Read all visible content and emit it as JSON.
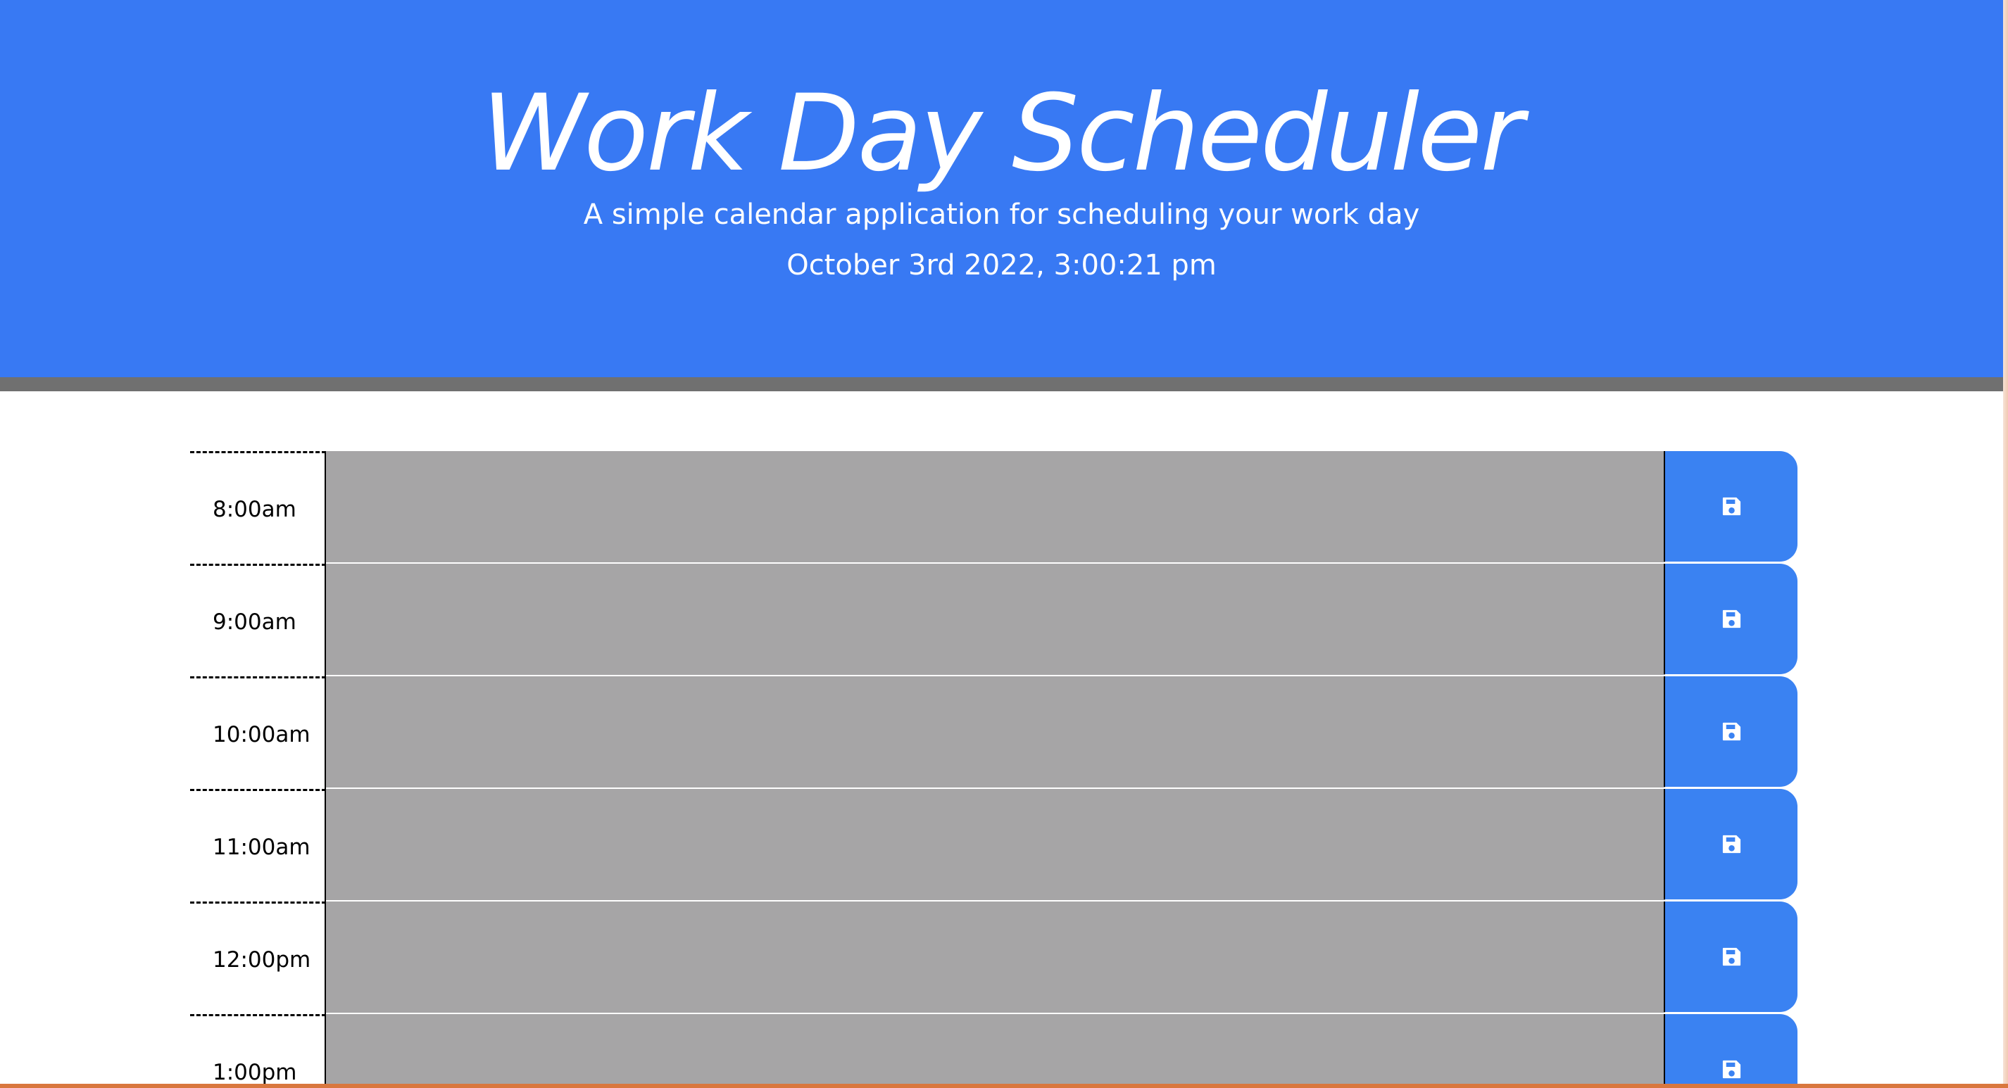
{
  "header": {
    "title": "Work Day Scheduler",
    "subtitle": "A simple calendar application for scheduling your work day",
    "current_day": "October 3rd 2022, 3:00:21 pm"
  },
  "timeblocks": [
    {
      "hour": "8:00am",
      "description": ""
    },
    {
      "hour": "9:00am",
      "description": ""
    },
    {
      "hour": "10:00am",
      "description": ""
    },
    {
      "hour": "11:00am",
      "description": ""
    },
    {
      "hour": "12:00pm",
      "description": ""
    },
    {
      "hour": "1:00pm",
      "description": ""
    }
  ],
  "save_icon": "save-icon",
  "colors": {
    "header_background": "#3879f3",
    "header_border": "#707070",
    "past_block": "#a6a5a6",
    "save_button": "#3a82f2"
  }
}
